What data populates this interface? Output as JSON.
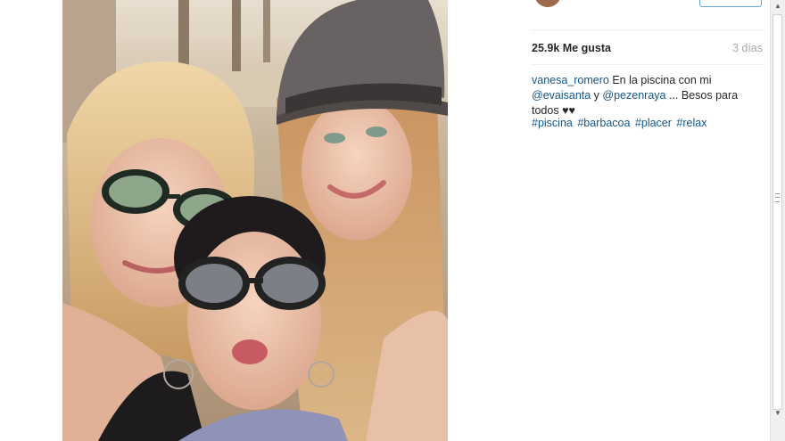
{
  "post": {
    "image_alt": "selfie",
    "likes": "25.9k Me gusta",
    "time_ago": "3 días",
    "caption": {
      "username": "vanesa_romero",
      "text_before": " En la piscina con mi ",
      "mention1": "@evaisanta",
      "text_middle": " y ",
      "mention2": "@pezenraya",
      "text_after": " ... Besos para todos ",
      "hearts": "♥♥"
    },
    "hashtags": [
      "#piscina",
      "#barbacoa",
      "#placer",
      "#relax"
    ]
  },
  "scrollbar": {
    "up_arrow": "▲",
    "down_arrow": "▼"
  },
  "colors": {
    "link": "#125688",
    "muted": "#a8a8a8",
    "text": "#262626"
  }
}
